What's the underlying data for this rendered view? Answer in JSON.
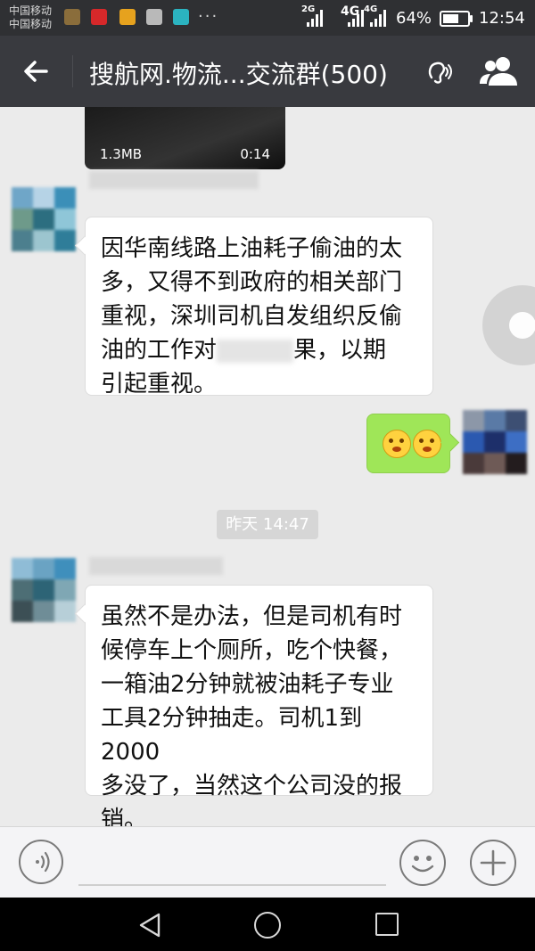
{
  "status_bar": {
    "carrier_1": "中国移动",
    "carrier_2": "中国移动",
    "notification_icons": [
      "photo-icon",
      "toutiao-icon",
      "app-icon",
      "huawei-icon",
      "mail-icon"
    ],
    "more_notifications": "···",
    "network_1": "2G",
    "network_2": "4G",
    "network_3": "4G",
    "battery_percent": "64%",
    "battery_level": 0.64,
    "time": "12:54"
  },
  "header": {
    "title": "搜航网.物流...交流群(500)",
    "back_icon": "back-arrow-icon",
    "earpiece_icon": "earpiece-mode-icon",
    "members_icon": "group-members-icon"
  },
  "chat": {
    "video_message": {
      "size": "1.3MB",
      "duration": "0:14"
    },
    "messages": [
      {
        "direction": "incoming",
        "lines": [
          "因华南线路上油耗子偷油的太",
          "多，又得不到政府的相关部门",
          "重视，深圳司机自发组织反偷"
        ],
        "line4_before": "油的工作对",
        "line4_after": "果，以期",
        "line5": "引起重视。"
      },
      {
        "direction": "outgoing",
        "emoji": [
          "scared-face-emoji",
          "scared-face-emoji"
        ]
      },
      {
        "direction": "incoming",
        "lines": [
          "虽然不是办法，但是司机有时",
          "候停车上个厕所，吃个快餐，",
          "一箱油2分钟就被油耗子专业",
          "工具2分钟抽走。司机1到2000",
          "多没了，当然这个公司没的报",
          "销。"
        ]
      }
    ],
    "timestamp": "昨天 14:47"
  },
  "input_bar": {
    "voice_icon": "voice-input-icon",
    "emoji_icon": "emoji-icon",
    "plus_icon": "more-plus-icon"
  },
  "nav_bar": {
    "back": "nav-back-icon",
    "home": "nav-home-icon",
    "recent": "nav-recent-icon"
  },
  "colors": {
    "header_bg": "#393a3f",
    "chat_bg": "#ebebeb",
    "outgoing_bubble": "#9fe658",
    "incoming_bubble": "#ffffff"
  }
}
